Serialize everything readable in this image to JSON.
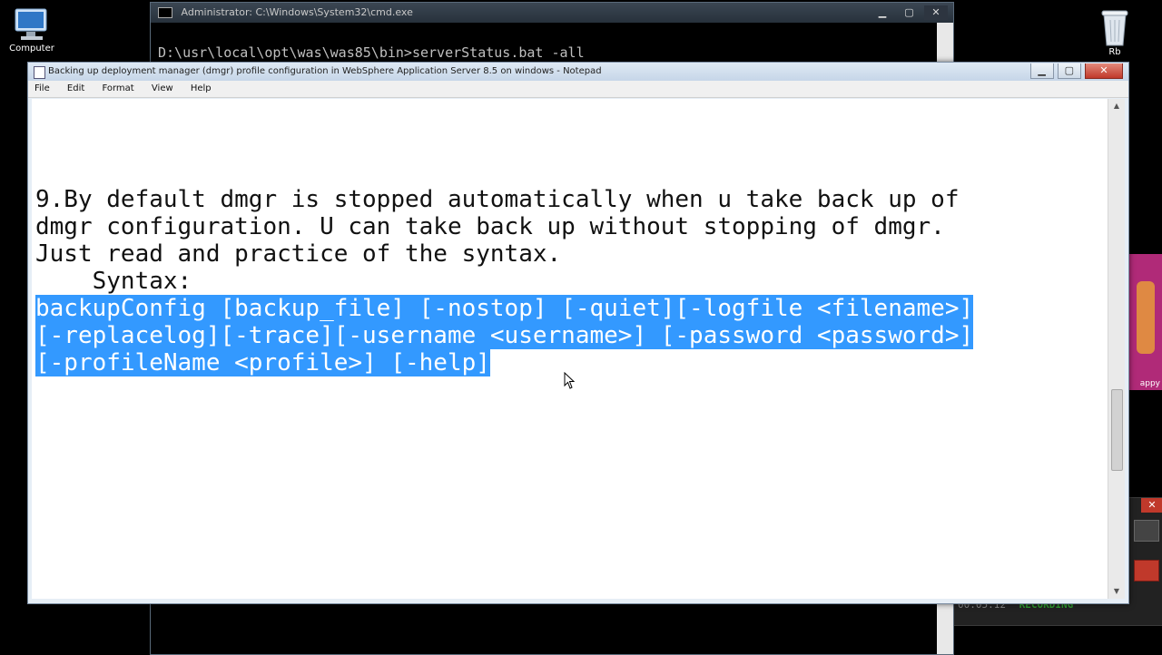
{
  "desktop": {
    "computer_label": "Computer",
    "recycle_label": "Rb"
  },
  "cmd": {
    "title": "Administrator: C:\\Windows\\System32\\cmd.exe",
    "command_line": "D:\\usr\\local\\opt\\was\\was85\\bin>serverStatus.bat -all"
  },
  "notepad": {
    "title": "Backing up deployment manager (dmgr) profile configuration in WebSphere Application Server 8.5 on windows - Notepad",
    "menu": [
      "File",
      "Edit",
      "Format",
      "View",
      "Help"
    ],
    "lines": {
      "line1": "9.By default dmgr is stopped automatically when u take back up of",
      "line2": "dmgr configuration. U can take back up without stopping of dmgr.",
      "line3": "Just read and practice of the syntax.",
      "line4": "    Syntax:",
      "sel1": "backupConfig [backup_file] [-nostop] [-quiet][-logfile <filename>]",
      "sel2": "[-replacelog][-trace][-username <username>] [-password <password>]",
      "sel3": "[-profileName <profile>] [-help]"
    }
  },
  "background_app": {
    "side_label": "appy"
  },
  "recorder": {
    "time": "00:05:12",
    "status": "RECORDING"
  },
  "colors": {
    "selection": "#3399ff",
    "recording": "#2e9d2e"
  }
}
